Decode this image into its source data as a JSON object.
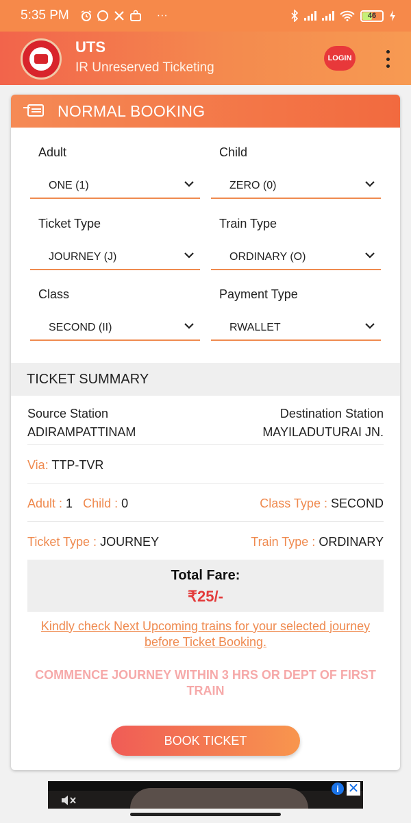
{
  "status_bar": {
    "time": "5:35 PM",
    "notification_icons": [
      "alarm-icon",
      "whatsapp-icon",
      "x-icon",
      "inbox-icon"
    ],
    "more": "···",
    "battery_level": "46",
    "battery_fraction": 0.46
  },
  "app_bar": {
    "title": "UTS",
    "subtitle": "IR Unreserved Ticketing",
    "login_label": "LOGIN"
  },
  "booking": {
    "header": "NORMAL BOOKING",
    "fields": {
      "adult": {
        "label": "Adult",
        "value": "ONE (1)"
      },
      "child": {
        "label": "Child",
        "value": "ZERO (0)"
      },
      "ticket_type": {
        "label": "Ticket Type",
        "value": "JOURNEY (J)"
      },
      "train_type": {
        "label": "Train Type",
        "value": "ORDINARY (O)"
      },
      "class": {
        "label": "Class",
        "value": "SECOND (II)"
      },
      "payment_type": {
        "label": "Payment Type",
        "value": "RWALLET"
      }
    }
  },
  "summary": {
    "header": "TICKET SUMMARY",
    "source_label": "Source Station",
    "source_value": "ADIRAMPATTINAM",
    "destination_label": "Destination Station",
    "destination_value": "MAYILADUTURAI JN.",
    "via_label": "Via:",
    "via_value": "TTP-TVR",
    "adult_label": "Adult :",
    "adult_value": "1",
    "child_label": "Child :",
    "child_value": "0",
    "class_type_label": "Class Type :",
    "class_type_value": "SECOND",
    "ticket_type_label": "Ticket Type :",
    "ticket_type_value": "JOURNEY",
    "train_type_label": "Train Type :",
    "train_type_value": "ORDINARY",
    "total_fare_label": "Total Fare:",
    "total_fare_value": "₹25/-"
  },
  "upcoming_link": "Kindly check Next Upcoming trains for your selected journey before Ticket Booking.",
  "notice": "COMMENCE JOURNEY WITHIN 3 HRS OR DEPT OF FIRST TRAIN",
  "book_button": "BOOK TICKET",
  "ad": {
    "info": "i",
    "close": "✕"
  },
  "colors": {
    "accent": "#ef8a4f",
    "header_gradient_start": "#f2644b",
    "header_gradient_end": "#f79a52",
    "fare_red": "#e33b3b",
    "notice_pink": "#f6a9a9"
  }
}
